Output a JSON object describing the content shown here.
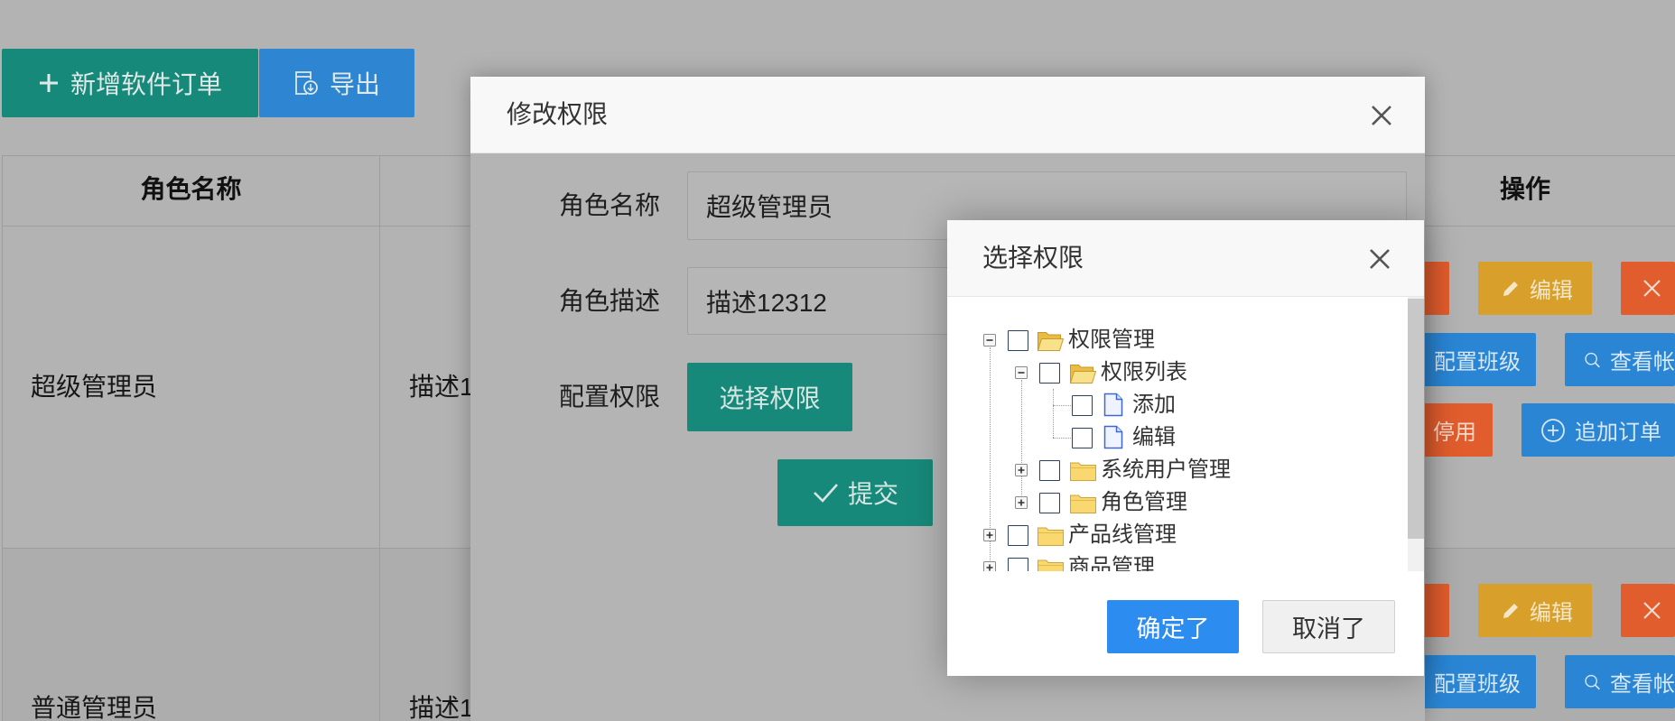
{
  "toolbar": {
    "new_order_label": "新增软件订单",
    "export_label": "导出"
  },
  "table": {
    "headers": {
      "role_name": "角色名称",
      "actions": "操作"
    },
    "rows": [
      {
        "name": "超级管理员",
        "desc": "描述1"
      },
      {
        "name": "普通管理员",
        "desc": "描述1"
      }
    ],
    "action_labels": {
      "edit": "编辑",
      "config_class": "配置班级",
      "view_account": "查看帐",
      "disable": "停用",
      "add_order": "追加订单"
    }
  },
  "edit_dialog": {
    "title": "修改权限",
    "role_name_label": "角色名称",
    "role_name_value": "超级管理员",
    "role_desc_label": "角色描述",
    "role_desc_value": "描述12312",
    "permission_label": "配置权限",
    "select_button": "选择权限",
    "submit_button": "提交"
  },
  "permission_dialog": {
    "title": "选择权限",
    "tree": [
      {
        "label": "权限管理",
        "level": 0,
        "expanded": true,
        "checked": false,
        "icon": "folder-open-icon"
      },
      {
        "label": "权限列表",
        "level": 1,
        "expanded": true,
        "checked": false,
        "icon": "folder-open-icon"
      },
      {
        "label": "添加",
        "level": 2,
        "checked": false,
        "icon": "document-icon"
      },
      {
        "label": "编辑",
        "level": 2,
        "checked": false,
        "icon": "document-icon"
      },
      {
        "label": "系统用户管理",
        "level": 1,
        "expanded": false,
        "checked": false,
        "icon": "folder-icon"
      },
      {
        "label": "角色管理",
        "level": 1,
        "expanded": false,
        "checked": false,
        "icon": "folder-icon"
      },
      {
        "label": "产品线管理",
        "level": 0,
        "expanded": false,
        "checked": false,
        "icon": "folder-icon"
      },
      {
        "label": "商品管理",
        "level": 0,
        "expanded": false,
        "checked": false,
        "icon": "folder-icon"
      }
    ],
    "ok_button": "确定了",
    "cancel_button": "取消了"
  },
  "colors": {
    "overlay_bg": "#b3b3b3",
    "teal": "#17897a",
    "primary_blue": "#2d8cf0",
    "action_blue": "#2a86d5",
    "warning_yellow": "#d8a02a",
    "danger_orange": "#e25d2d"
  }
}
